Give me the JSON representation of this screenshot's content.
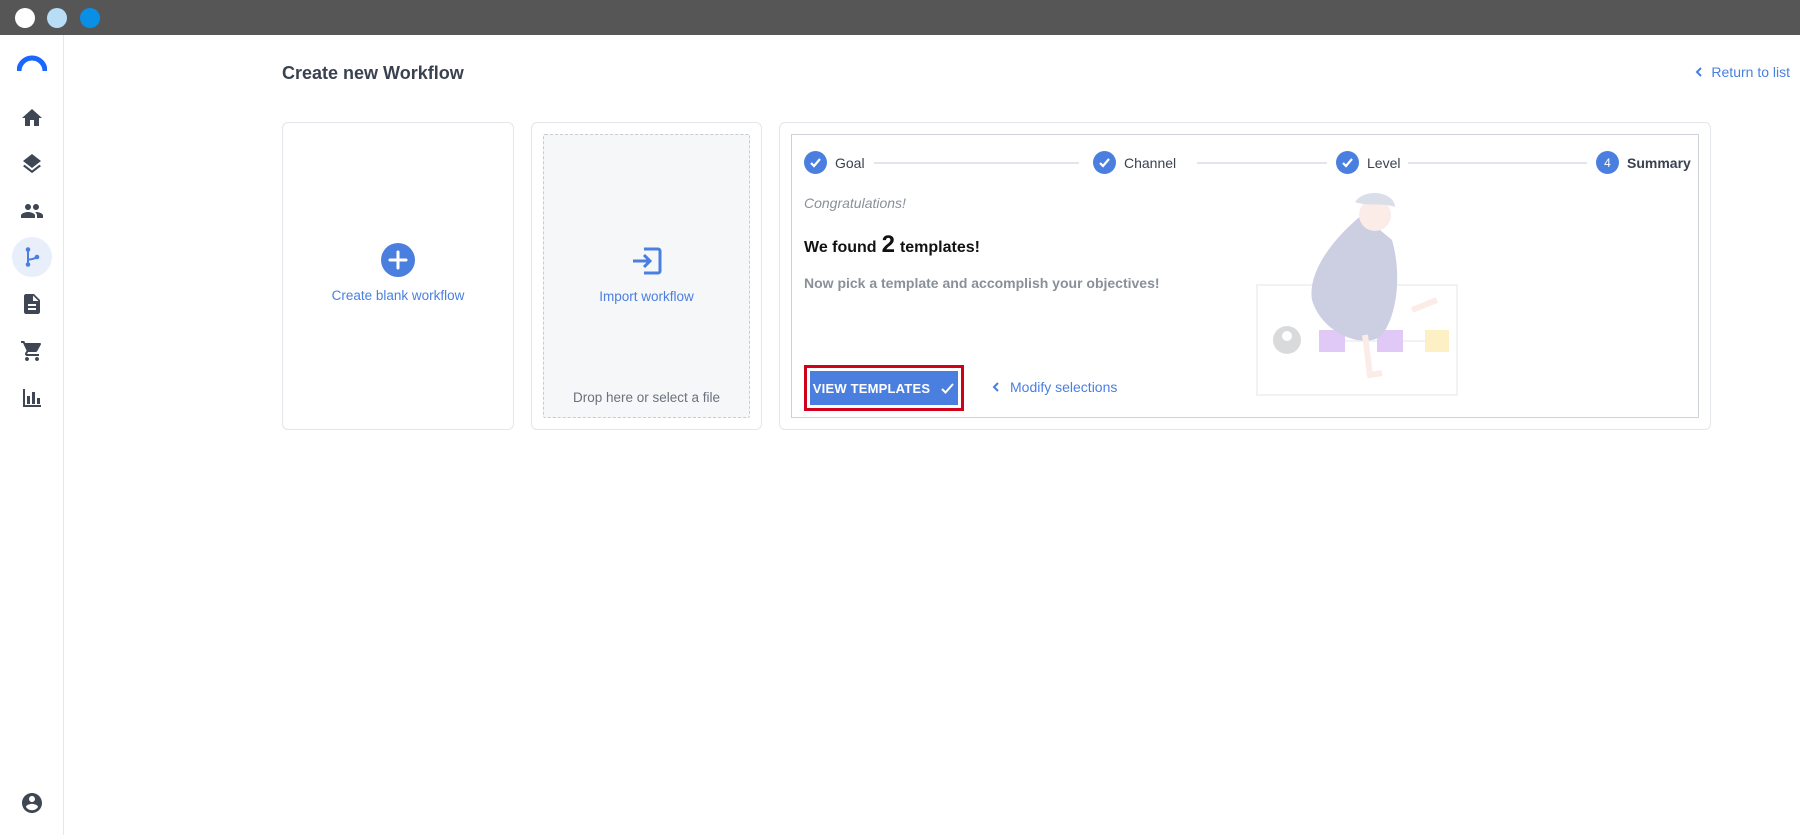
{
  "window": {
    "controls": [
      "close",
      "minimize",
      "maximize"
    ]
  },
  "sidebar": {
    "logo": "brand-logo",
    "items": [
      {
        "name": "home",
        "icon": "home-icon",
        "active": false
      },
      {
        "name": "layers",
        "icon": "layers-icon",
        "active": false
      },
      {
        "name": "people",
        "icon": "people-icon",
        "active": false
      },
      {
        "name": "workflows",
        "icon": "workflow-icon",
        "active": true
      },
      {
        "name": "documents",
        "icon": "document-icon",
        "active": false
      },
      {
        "name": "cart",
        "icon": "cart-icon",
        "active": false
      },
      {
        "name": "analytics",
        "icon": "bar-chart-icon",
        "active": false
      }
    ],
    "account_icon": "account-icon"
  },
  "header": {
    "title": "Create new Workflow",
    "return_label": "Return to list"
  },
  "cards": {
    "blank": {
      "label": "Create blank workflow"
    },
    "import": {
      "label": "Import workflow",
      "drop_hint": "Drop here or select a file"
    }
  },
  "wizard": {
    "steps": [
      {
        "label": "Goal",
        "state": "done"
      },
      {
        "label": "Channel",
        "state": "done"
      },
      {
        "label": "Level",
        "state": "done"
      },
      {
        "label": "Summary",
        "state": "current",
        "number": "4"
      }
    ],
    "congrats": "Congratulations!",
    "found_prefix": "We found",
    "found_count": "2",
    "found_suffix": "templates!",
    "subtitle": "Now pick a template and accomplish your objectives!",
    "view_button": "VIEW TEMPLATES",
    "modify_label": "Modify selections"
  },
  "colors": {
    "accent": "#4a7fe0",
    "highlight": "#d0021b",
    "titlebar": "#565656"
  }
}
